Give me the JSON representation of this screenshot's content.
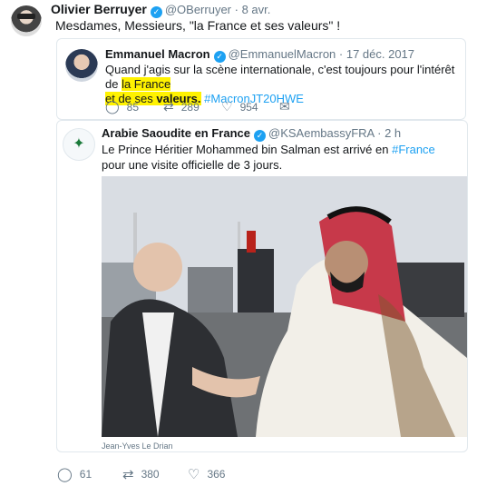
{
  "tweet": {
    "author_name": "Olivier Berruyer",
    "author_handle": "@OBerruyer",
    "date": "8 avr.",
    "text": "Mesdames, Messieurs, \"la France et ses valeurs\" !",
    "actions": {
      "replies": "61",
      "retweets": "380",
      "likes": "366"
    }
  },
  "quote1": {
    "author_name": "Emmanuel Macron",
    "author_handle": "@EmmanuelMacron",
    "date": "17 déc. 2017",
    "text_part1": "Quand j'agis sur la scène internationale, c'est toujours pour l'intérêt de ",
    "text_highlight1": "la France",
    "text_highlight2": "et de ses ",
    "text_highlight_bold": "valeurs.",
    "hashtag": "#MacronJT20HWE",
    "actions": {
      "replies": "85",
      "retweets": "289",
      "likes": "954"
    }
  },
  "quote2": {
    "author_name": "Arabie Saoudite en France",
    "author_handle": "@KSAembassyFRA",
    "date": "2 h",
    "text_part1": "Le Prince Héritier Mohammed bin Salman est arrivé en ",
    "hashtag": "#France",
    "text_part2": " pour une visite officielle de 3 jours.",
    "photo_caption": "Jean-Yves Le Drian"
  },
  "icons": {
    "verified": "verified-badge-icon",
    "reply": "reply-icon",
    "retweet": "retweet-icon",
    "like": "heart-icon",
    "dm": "envelope-icon"
  },
  "colors": {
    "link": "#1da1f2",
    "highlight": "#fff200",
    "muted": "#657786"
  }
}
